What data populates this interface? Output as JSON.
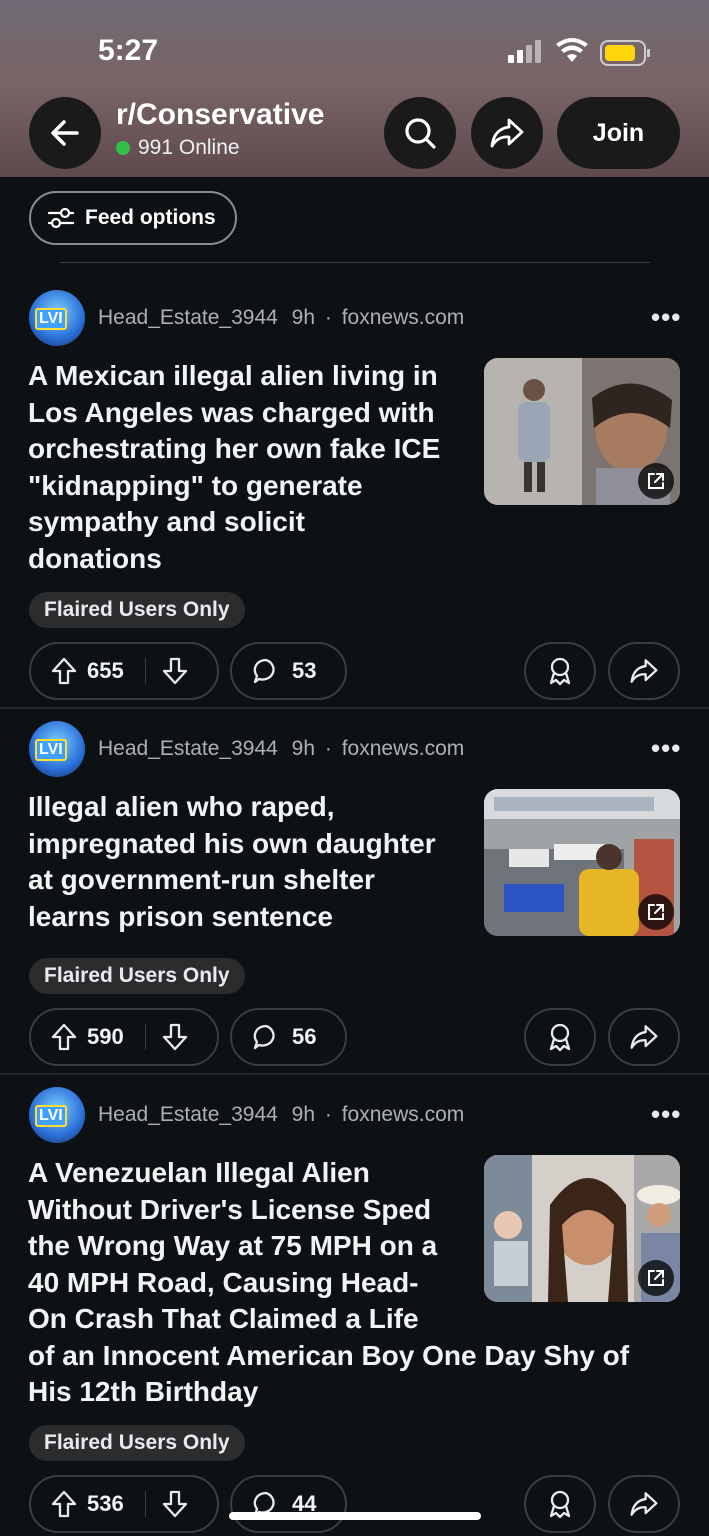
{
  "status_bar": {
    "time": "5:27"
  },
  "header": {
    "subreddit": "r/Conservative",
    "online": "991 Online",
    "join_label": "Join"
  },
  "feed_options_label": "Feed options",
  "colors": {
    "online_dot": "#2fc148",
    "background": "#0e1113"
  },
  "posts": [
    {
      "user": "Head_Estate_3944",
      "age": "9h",
      "domain": "foxnews.com",
      "title_lines": [
        "A Mexican illegal alien living in",
        "Los Angeles was charged with",
        "orchestrating her own fake ICE",
        "\"kidnapping\" to generate",
        "sympathy and solicit",
        "donations"
      ],
      "flair": "Flaired Users Only",
      "votes": "655",
      "comments": "53"
    },
    {
      "user": "Head_Estate_3944",
      "age": "9h",
      "domain": "foxnews.com",
      "title_lines": [
        "Illegal alien who raped,",
        "impregnated his own daughter",
        "at government-run shelter",
        "learns prison sentence"
      ],
      "flair": "Flaired Users Only",
      "votes": "590",
      "comments": "56"
    },
    {
      "user": "Head_Estate_3944",
      "age": "9h",
      "domain": "foxnews.com",
      "title_lines": [
        "A Venezuelan Illegal Alien",
        "Without Driver's License Sped",
        "the Wrong Way at 75 MPH on a",
        "40 MPH Road, Causing Head-",
        "On Crash That Claimed a Life",
        "of an Innocent American Boy One Day Shy of",
        "His 12th Birthday"
      ],
      "flair": "Flaired Users Only",
      "votes": "536",
      "comments": "44"
    }
  ]
}
